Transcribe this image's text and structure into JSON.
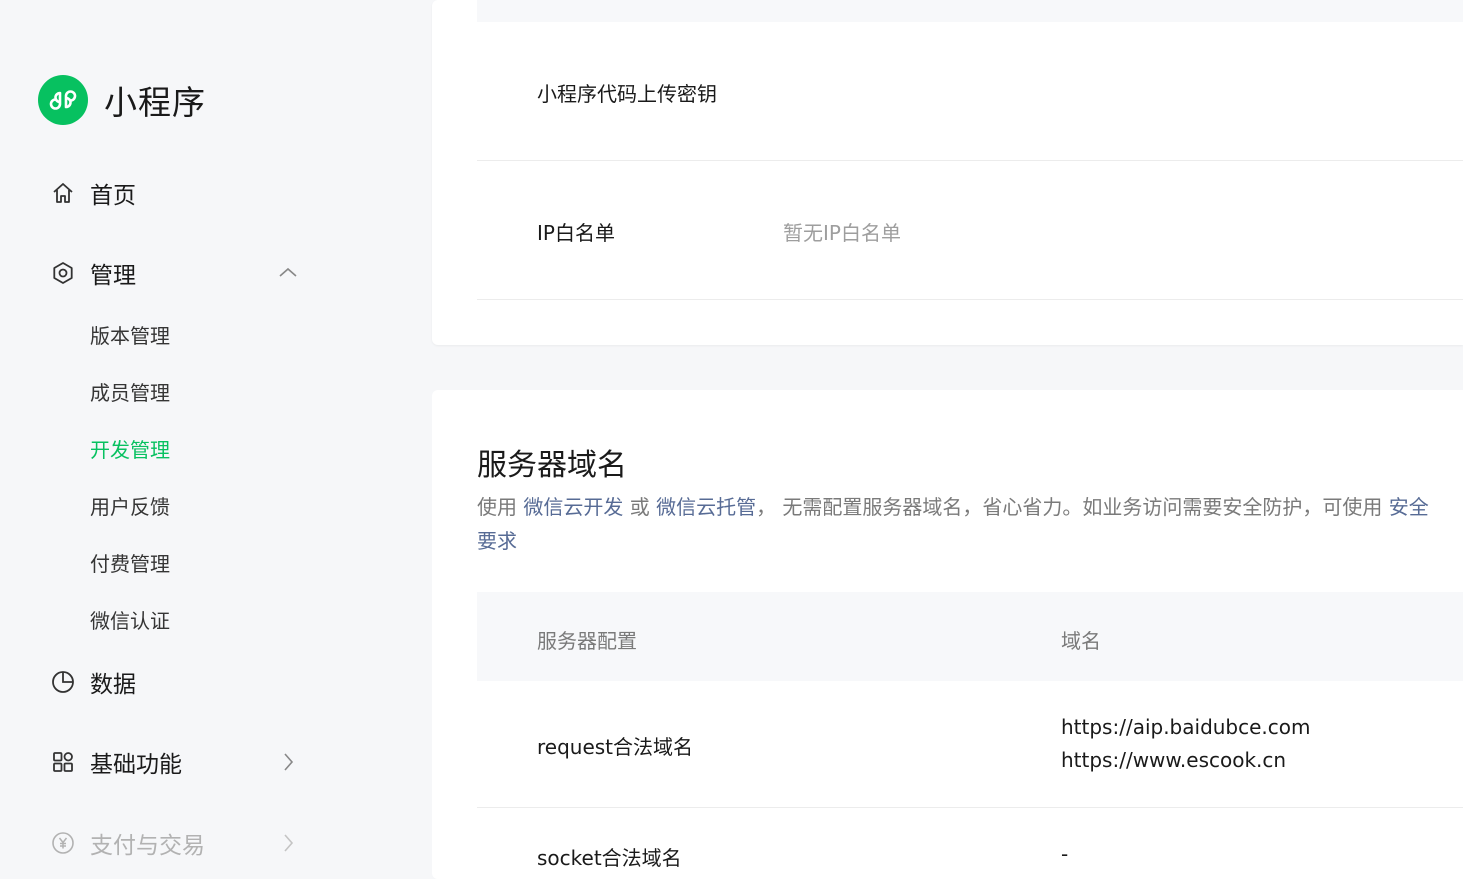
{
  "app": {
    "title": "小程序",
    "brand_color": "#07c160"
  },
  "sidebar": {
    "items": [
      {
        "label": "首页",
        "icon": "home-icon"
      },
      {
        "label": "管理",
        "icon": "settings-icon",
        "expanded": true,
        "children": [
          {
            "label": "版本管理"
          },
          {
            "label": "成员管理"
          },
          {
            "label": "开发管理",
            "active": true
          },
          {
            "label": "用户反馈"
          },
          {
            "label": "付费管理"
          },
          {
            "label": "微信认证"
          }
        ]
      },
      {
        "label": "数据",
        "icon": "pie-chart-icon"
      },
      {
        "label": "基础功能",
        "icon": "grid-icon"
      },
      {
        "label": "支付与交易",
        "icon": "yuan-icon",
        "disabled": true
      }
    ]
  },
  "dev_settings": {
    "rows": [
      {
        "label": "小程序代码上传密钥",
        "value": ""
      },
      {
        "label": "IP白名单",
        "value": "暂无IP白名单"
      }
    ]
  },
  "server_domain": {
    "title": "服务器域名",
    "desc_prefix": "使用 ",
    "link1": "微信云开发",
    "desc_or": " 或 ",
    "link2": "微信云托管",
    "desc_rest": "， 无需配置服务器域名，省心省力。如业务访问需要安全防护，可使用 ",
    "link3": "安全",
    "link_line2": "要求",
    "table": {
      "headers": [
        "服务器配置",
        "域名"
      ],
      "rows": [
        {
          "name": "request合法域名",
          "domains": [
            "https://aip.baidubce.com",
            "https://www.escook.cn"
          ]
        },
        {
          "name": "socket合法域名",
          "domains": [
            "-"
          ]
        }
      ]
    }
  }
}
